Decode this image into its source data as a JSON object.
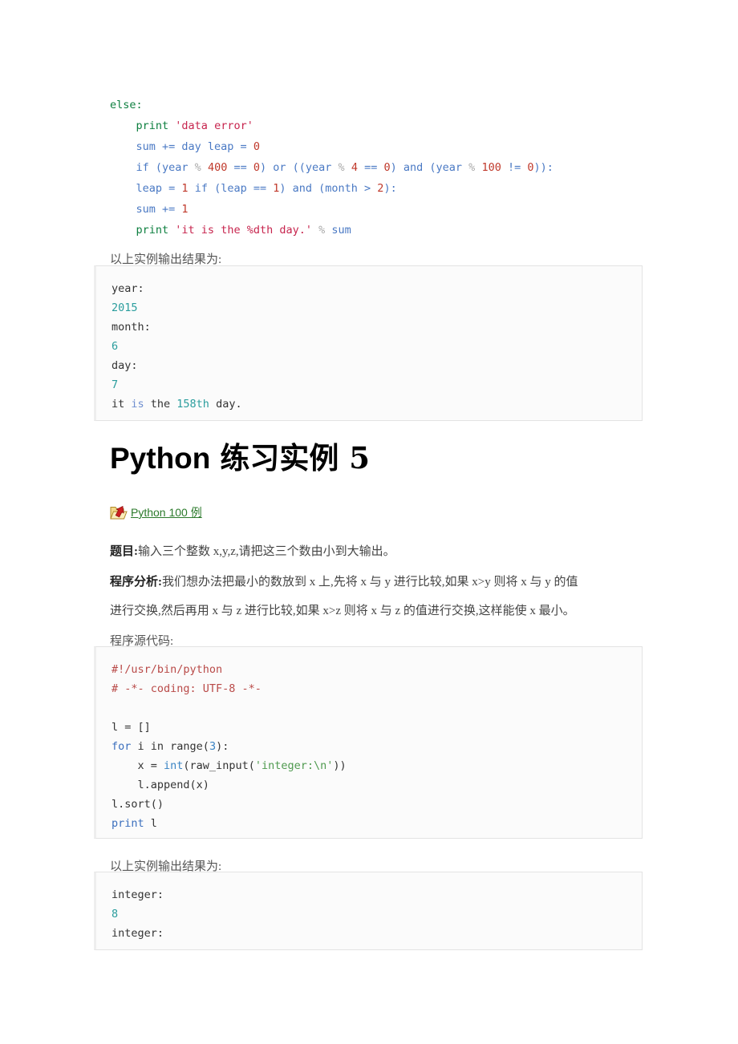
{
  "page": {
    "title": "Python 练习实例 5",
    "title_latin": "Python",
    "title_cn": "练习实例 5"
  },
  "top_code": {
    "lines": [
      [
        {
          "t": "else:",
          "c": "kw"
        }
      ],
      [
        {
          "t": "    ",
          "c": ""
        },
        {
          "t": "print",
          "c": "kw"
        },
        {
          "t": " ",
          "c": ""
        },
        {
          "t": "'data error'",
          "c": "str-red"
        }
      ],
      [
        {
          "t": "    ",
          "c": ""
        },
        {
          "t": "sum += day leap = ",
          "c": "blu"
        },
        {
          "t": "0",
          "c": "num-red"
        }
      ],
      [
        {
          "t": "    ",
          "c": ""
        },
        {
          "t": "if (year ",
          "c": "blu"
        },
        {
          "t": "%",
          "c": "gry"
        },
        {
          "t": " ",
          "c": ""
        },
        {
          "t": "400",
          "c": "num-red"
        },
        {
          "t": " == ",
          "c": "blu"
        },
        {
          "t": "0",
          "c": "num-red"
        },
        {
          "t": ") or ((year ",
          "c": "blu"
        },
        {
          "t": "%",
          "c": "gry"
        },
        {
          "t": " ",
          "c": ""
        },
        {
          "t": "4",
          "c": "num-red"
        },
        {
          "t": " == ",
          "c": "blu"
        },
        {
          "t": "0",
          "c": "num-red"
        },
        {
          "t": ") and (year ",
          "c": "blu"
        },
        {
          "t": "%",
          "c": "gry"
        },
        {
          "t": " ",
          "c": ""
        },
        {
          "t": "100",
          "c": "num-red"
        },
        {
          "t": " != ",
          "c": "blu"
        },
        {
          "t": "0",
          "c": "num-red"
        },
        {
          "t": ")):",
          "c": "blu"
        }
      ],
      [
        {
          "t": "    ",
          "c": ""
        },
        {
          "t": "leap = ",
          "c": "blu"
        },
        {
          "t": "1",
          "c": "num-red"
        },
        {
          "t": " if (leap == ",
          "c": "blu"
        },
        {
          "t": "1",
          "c": "num-red"
        },
        {
          "t": ") and (month > ",
          "c": "blu"
        },
        {
          "t": "2",
          "c": "num-red"
        },
        {
          "t": "):",
          "c": "blu"
        }
      ],
      [
        {
          "t": "    ",
          "c": ""
        },
        {
          "t": "sum += ",
          "c": "blu"
        },
        {
          "t": "1",
          "c": "num-red"
        }
      ],
      [
        {
          "t": "    ",
          "c": ""
        },
        {
          "t": "print",
          "c": "kw"
        },
        {
          "t": " ",
          "c": ""
        },
        {
          "t": "'it is the %dth day.'",
          "c": "str-red"
        },
        {
          "t": " ",
          "c": ""
        },
        {
          "t": "%",
          "c": "gry"
        },
        {
          "t": " sum",
          "c": "blu"
        }
      ]
    ]
  },
  "output1": {
    "caption": "以上实例输出结果为:",
    "lines": [
      [
        {
          "t": "year:",
          "c": ""
        }
      ],
      [
        {
          "t": "2015",
          "c": "out-teal"
        }
      ],
      [
        {
          "t": "month:",
          "c": ""
        }
      ],
      [
        {
          "t": "6",
          "c": "out-teal"
        }
      ],
      [
        {
          "t": "day:",
          "c": ""
        }
      ],
      [
        {
          "t": "7",
          "c": "out-teal"
        }
      ],
      [
        {
          "t": "it ",
          "c": ""
        },
        {
          "t": "is",
          "c": "out-blu"
        },
        {
          "t": " the ",
          "c": ""
        },
        {
          "t": "158th",
          "c": "out-teal"
        },
        {
          "t": " day.",
          "c": ""
        }
      ]
    ]
  },
  "link": {
    "label": "Python 100 例",
    "icon": "folder-arrow-icon",
    "color": "#2b7a2b"
  },
  "problem": {
    "label": "题目:",
    "text": "输入三个整数 x,y,z,请把这三个数由小到大输出。"
  },
  "analysis": {
    "label": "程序分析:",
    "line1": "我们想办法把最小的数放到 x 上,先将 x 与 y 进行比较,如果 x>y 则将 x 与 y 的值",
    "line2": "进行交换,然后再用 x 与 z 进行比较,如果 x>z 则将 x 与 z 的值进行交换,这样能使 x 最小。"
  },
  "source_caption": "程序源代码:",
  "source_code": {
    "lines": [
      [
        {
          "t": "#!/usr/bin/python",
          "c": "com"
        }
      ],
      [
        {
          "t": "# -*- coding: UTF-8 -*-",
          "c": "com"
        }
      ],
      [
        {
          "t": "",
          "c": ""
        }
      ],
      [
        {
          "t": "l = []",
          "c": ""
        }
      ],
      [
        {
          "t": "for",
          "c": "kw2"
        },
        {
          "t": " i in range(",
          "c": ""
        },
        {
          "t": "3",
          "c": "num-blu"
        },
        {
          "t": "):",
          "c": ""
        }
      ],
      [
        {
          "t": "    x = ",
          "c": ""
        },
        {
          "t": "int",
          "c": "fn"
        },
        {
          "t": "(raw_input(",
          "c": ""
        },
        {
          "t": "'integer:\\n'",
          "c": "str-grn"
        },
        {
          "t": "))",
          "c": ""
        }
      ],
      [
        {
          "t": "    l.append(x)",
          "c": ""
        }
      ],
      [
        {
          "t": "l.sort()",
          "c": ""
        }
      ],
      [
        {
          "t": "print",
          "c": "kw2"
        },
        {
          "t": " l",
          "c": ""
        }
      ]
    ]
  },
  "output2": {
    "caption": "以上实例输出结果为:",
    "lines": [
      [
        {
          "t": "integer:",
          "c": ""
        }
      ],
      [
        {
          "t": "8",
          "c": "out-teal"
        }
      ],
      [
        {
          "t": "integer:",
          "c": ""
        }
      ]
    ]
  }
}
